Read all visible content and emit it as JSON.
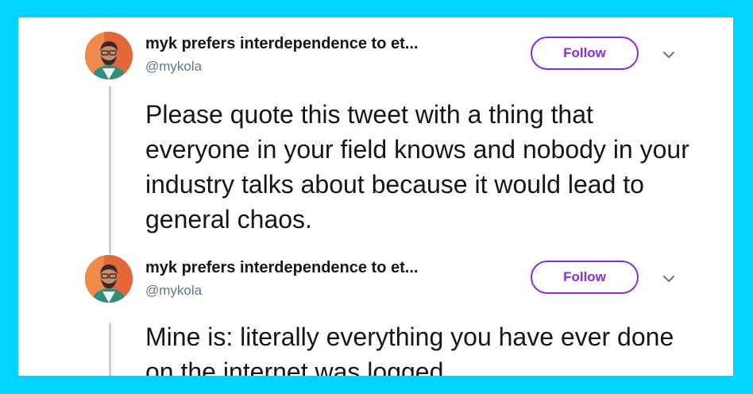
{
  "colors": {
    "background": "#00d4ff",
    "accent": "#8a2be2",
    "thread_line": "#d7c3ee"
  },
  "tweets": [
    {
      "display_name": "myk prefers interdependence to et...",
      "handle": "@mykola",
      "follow_label": "Follow",
      "menu_icon": "chevron-down-icon",
      "text": "Please quote this tweet with a thing that everyone in your field knows and nobody in your industry talks about because it would lead to general chaos."
    },
    {
      "display_name": "myk prefers interdependence to et...",
      "handle": "@mykola",
      "follow_label": "Follow",
      "menu_icon": "chevron-down-icon",
      "text": "Mine is: literally everything you have ever done on the internet was logged"
    }
  ]
}
